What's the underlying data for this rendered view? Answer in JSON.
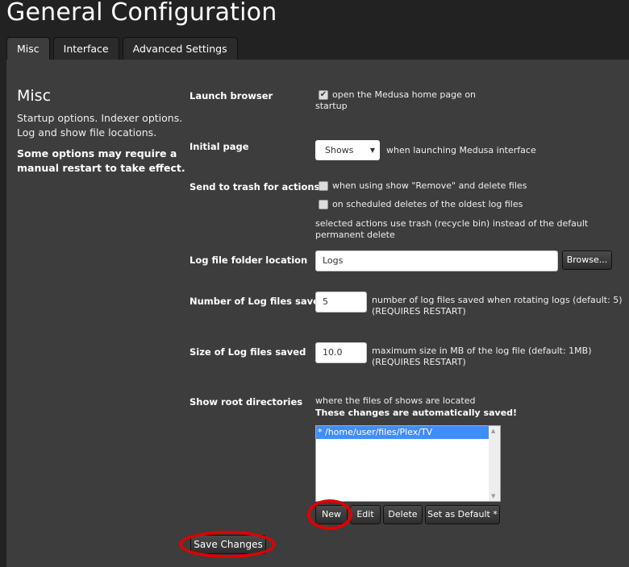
{
  "header": {
    "title": "General Configuration"
  },
  "tabs": [
    {
      "label": "Misc",
      "active": true
    },
    {
      "label": "Interface",
      "active": false
    },
    {
      "label": "Advanced Settings",
      "active": false
    }
  ],
  "section": {
    "title": "Misc",
    "description": "Startup options. Indexer options. Log and show file locations.",
    "note": "Some options may require a manual restart to take effect."
  },
  "launch_browser": {
    "label": "Launch browser",
    "checked": true,
    "check_glyph": "✔",
    "text_line1": "open the Medusa home page on",
    "text_line2": "startup"
  },
  "initial_page": {
    "label": "Initial page",
    "selected": "Shows",
    "arrow": "▼",
    "suffix": "when launching Medusa interface"
  },
  "send_to_trash": {
    "label": "Send to trash for actions",
    "option1": "when using show \"Remove\" and delete files",
    "option2": "on scheduled deletes of the oldest log files",
    "note": "selected actions use trash (recycle bin) instead of the default permanent delete"
  },
  "log_folder": {
    "label": "Log file folder location",
    "value": "Logs",
    "browse_label": "Browse..."
  },
  "log_count": {
    "label": "Number of Log files saved",
    "value": "5",
    "help1": "number of log files saved when rotating logs (default: 5)",
    "help2": "(REQUIRES RESTART)"
  },
  "log_size": {
    "label": "Size of Log files saved",
    "value": "10.0",
    "help1": "maximum size in MB of the log file (default: 1MB)",
    "help2": "(REQUIRES RESTART)"
  },
  "root_dirs": {
    "label": "Show root directories",
    "help": "where the files of shows are located",
    "note": "These changes are automatically saved!",
    "items": [
      "* /home/user/files/Plex/TV"
    ],
    "buttons": {
      "new": "New",
      "edit": "Edit",
      "delete": "Delete",
      "default": "Set as Default *"
    }
  },
  "footer": {
    "save_label": "Save Changes"
  },
  "colors": {
    "annotation": "#e00000",
    "selection": "#3d8ef8",
    "panel": "#3d3d3d",
    "background": "#222222"
  }
}
